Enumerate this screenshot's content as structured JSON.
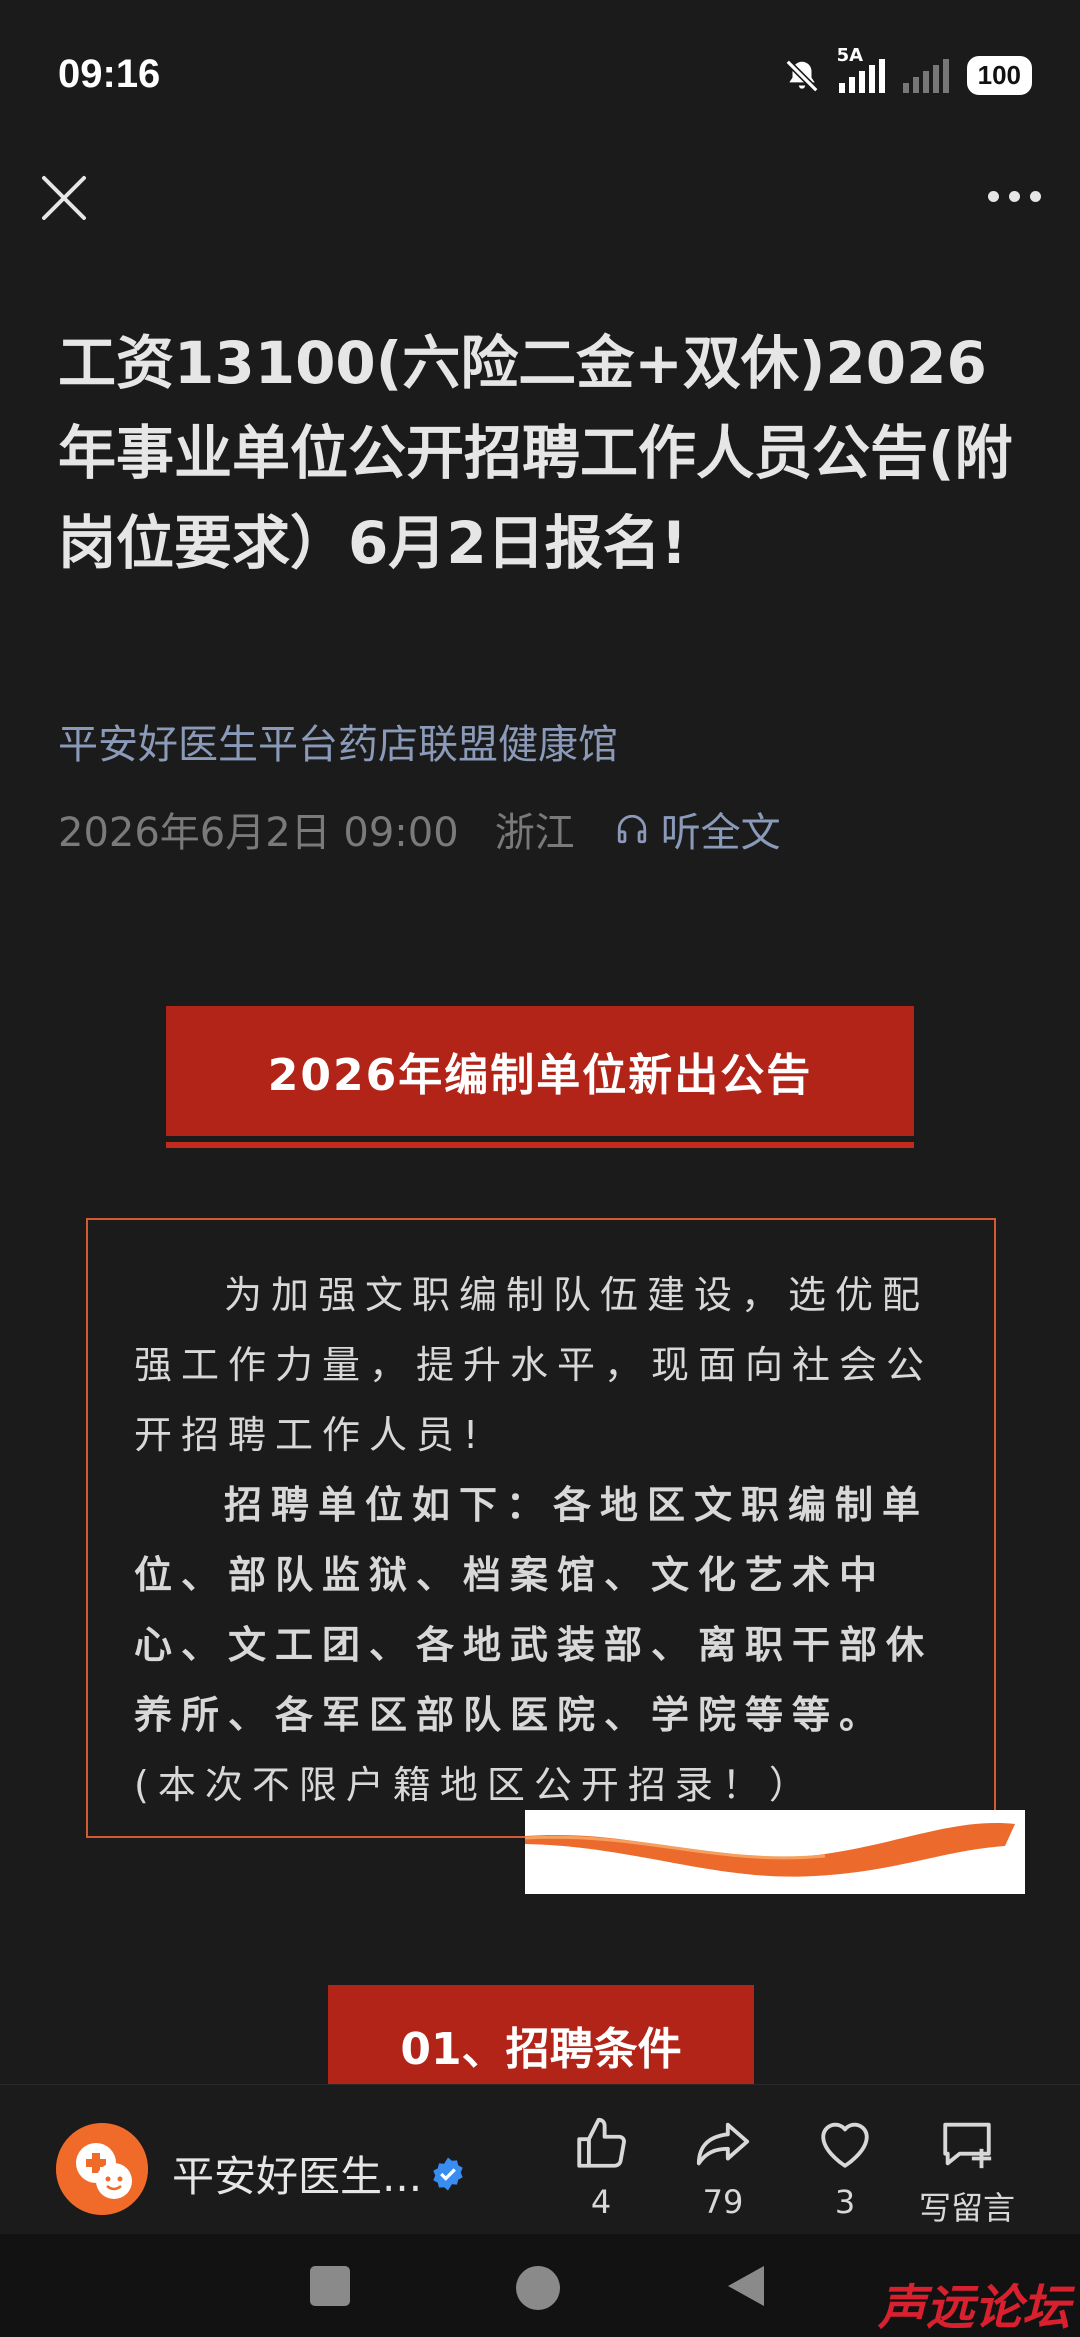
{
  "status_bar": {
    "time": "09:16",
    "network_label": "5A",
    "battery": "100"
  },
  "nav": {
    "close_icon": "close-icon",
    "more_icon": "more-icon"
  },
  "article": {
    "title": "工资13100(六险二金+双休)2026年事业单位公开招聘工作人员公告(附岗位要求）6月2日报名!",
    "source": "平安好医生平台药店联盟健康馆",
    "date": "2026年6月2日 09:00",
    "region": "浙江",
    "listen_label": "听全文",
    "banner": "2026年编制单位新出公告",
    "intro_p1": "为加强文职编制队伍建设，选优配强工作力量，提升水平，现面向社会公开招聘工作人员!",
    "intro_p2_bold": "招聘单位如下：各地区文职编制单位、部队监狱、档案馆、文化艺术中心、文工团、各地武装部、离职干部休养所、各军区部队医院、学院等等。",
    "intro_p2_rest": "(本次不限户籍地区公开招录！）",
    "section_title": "01、招聘条件"
  },
  "action_bar": {
    "author": "平安好医生...",
    "like_count": "4",
    "share_count": "79",
    "fav_count": "3",
    "comment_label": "写留言"
  },
  "watermark": "声远论坛",
  "colors": {
    "background": "#1b1b1b",
    "banner_red": "#b22318",
    "link_blue": "#8a9ab8",
    "border_orange": "#d45a33",
    "avatar_orange": "#f06a2a"
  }
}
